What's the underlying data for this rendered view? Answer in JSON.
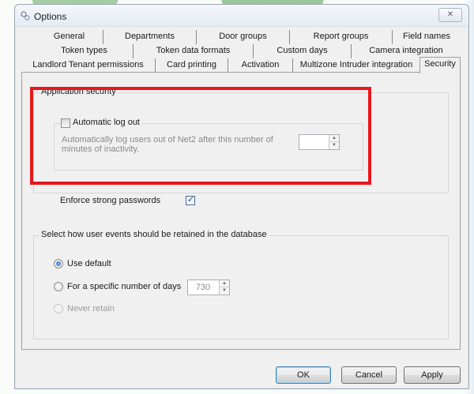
{
  "window": {
    "title": "Options",
    "close_glyph": "✕"
  },
  "tabs": {
    "row1": [
      "General",
      "Departments",
      "Door groups",
      "Report groups",
      "Field names"
    ],
    "row2": [
      "Token types",
      "Token data formats",
      "Custom days",
      "Camera integration"
    ],
    "row3": [
      "Landlord Tenant permissions",
      "Card printing",
      "Activation",
      "Multizone Intruder integration",
      "Security"
    ],
    "active": "Security"
  },
  "app_security": {
    "legend": "Application security",
    "auto_logout_label": "Automatic log out",
    "auto_logout_checked": false,
    "description": "Automatically log users out of Net2 after this number of minutes of inactivity.",
    "minutes_value": ""
  },
  "strong_passwords": {
    "label": "Enforce strong passwords",
    "checked": true
  },
  "retention": {
    "legend": "Select how user events should be retained in the database",
    "options": [
      "Use default",
      "For a specific number of days",
      "Never retain"
    ],
    "selected": "Use default",
    "days_value": "730"
  },
  "buttons": {
    "ok": "OK",
    "cancel": "Cancel",
    "apply": "Apply"
  },
  "colors": {
    "highlight_box": "#e8171b",
    "accent": "#2a5fb0"
  }
}
